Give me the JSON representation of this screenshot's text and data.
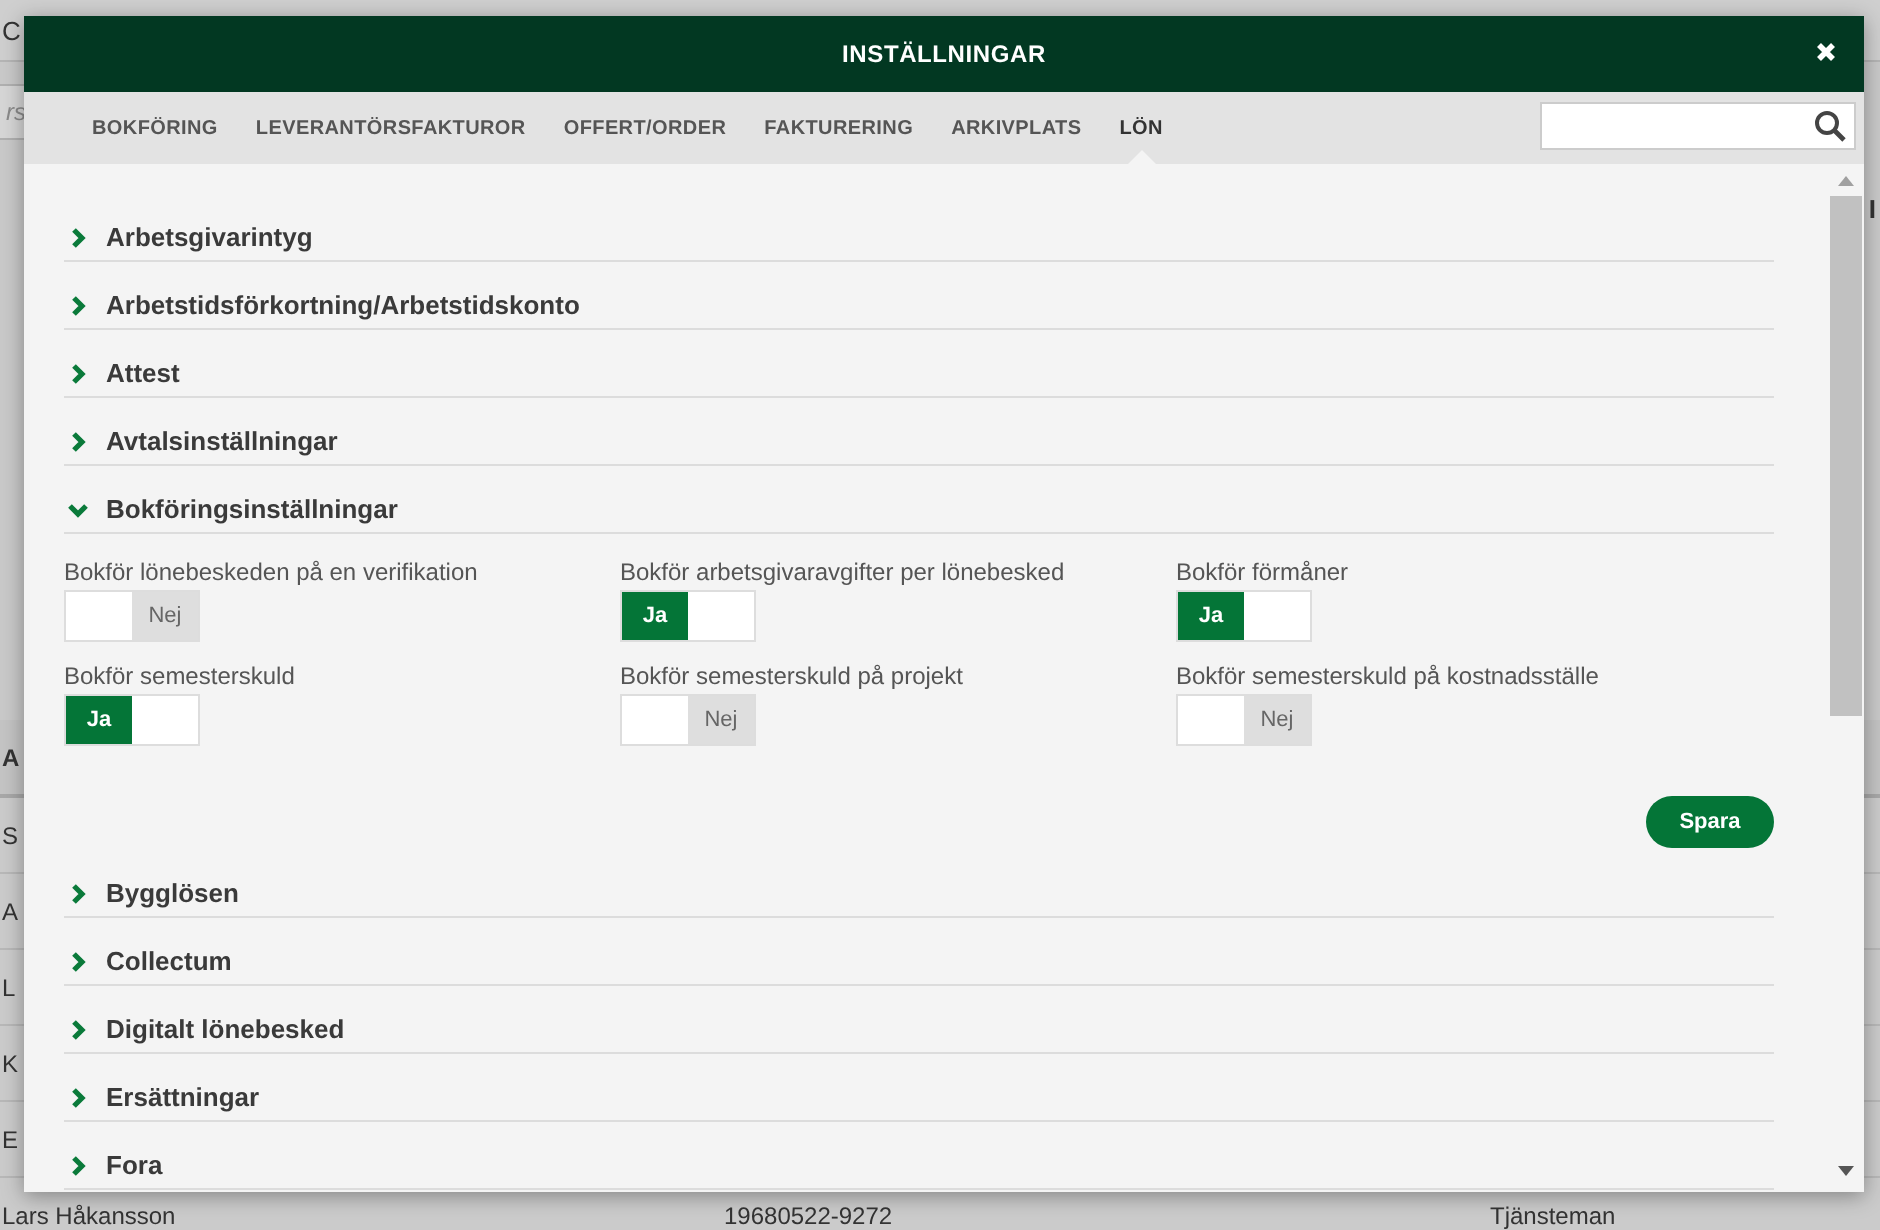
{
  "background": {
    "title": "C",
    "search_placeholder": "rs",
    "side_label": "I",
    "table": {
      "header": "A",
      "rows": [
        [
          "S"
        ],
        [
          "A"
        ],
        [
          "L"
        ],
        [
          "K"
        ],
        [
          "E"
        ],
        [
          "Lars Håkansson",
          "19680522-9272",
          "Tjänsteman"
        ]
      ]
    }
  },
  "dialog": {
    "title": "INSTÄLLNINGAR",
    "tabs": [
      {
        "label": "BOKFÖRING",
        "selected": false
      },
      {
        "label": "LEVERANTÖRSFAKTUROR",
        "selected": false
      },
      {
        "label": "OFFERT/ORDER",
        "selected": false
      },
      {
        "label": "FAKTURERING",
        "selected": false
      },
      {
        "label": "ARKIVPLATS",
        "selected": false
      },
      {
        "label": "LÖN",
        "selected": true
      }
    ],
    "sections": [
      {
        "title": "Arbetsgivarintyg",
        "expanded": false
      },
      {
        "title": "Arbetstidsförkortning/Arbetstidskonto",
        "expanded": false
      },
      {
        "title": "Attest",
        "expanded": false
      },
      {
        "title": "Avtalsinställningar",
        "expanded": false
      },
      {
        "title": "Bokföringsinställningar",
        "expanded": true,
        "save_button": "Spara",
        "settings": [
          {
            "label": "Bokför lönebeskeden på en verifikation",
            "on": false,
            "value_text": "Nej"
          },
          {
            "label": "Bokför arbetsgivaravgifter per lönebesked",
            "on": true,
            "value_text": "Ja"
          },
          {
            "label": "Bokför förmåner",
            "on": true,
            "value_text": "Ja"
          },
          {
            "label": "Bokför semesterskuld",
            "on": true,
            "value_text": "Ja"
          },
          {
            "label": "Bokför semesterskuld på projekt",
            "on": false,
            "value_text": "Nej"
          },
          {
            "label": "Bokför semesterskuld på kostnadsställe",
            "on": false,
            "value_text": "Nej"
          }
        ]
      },
      {
        "title": "Bygglösen",
        "expanded": false
      },
      {
        "title": "Collectum",
        "expanded": false
      },
      {
        "title": "Digitalt lönebesked",
        "expanded": false
      },
      {
        "title": "Ersättningar",
        "expanded": false
      },
      {
        "title": "Fora",
        "expanded": false
      }
    ]
  }
}
